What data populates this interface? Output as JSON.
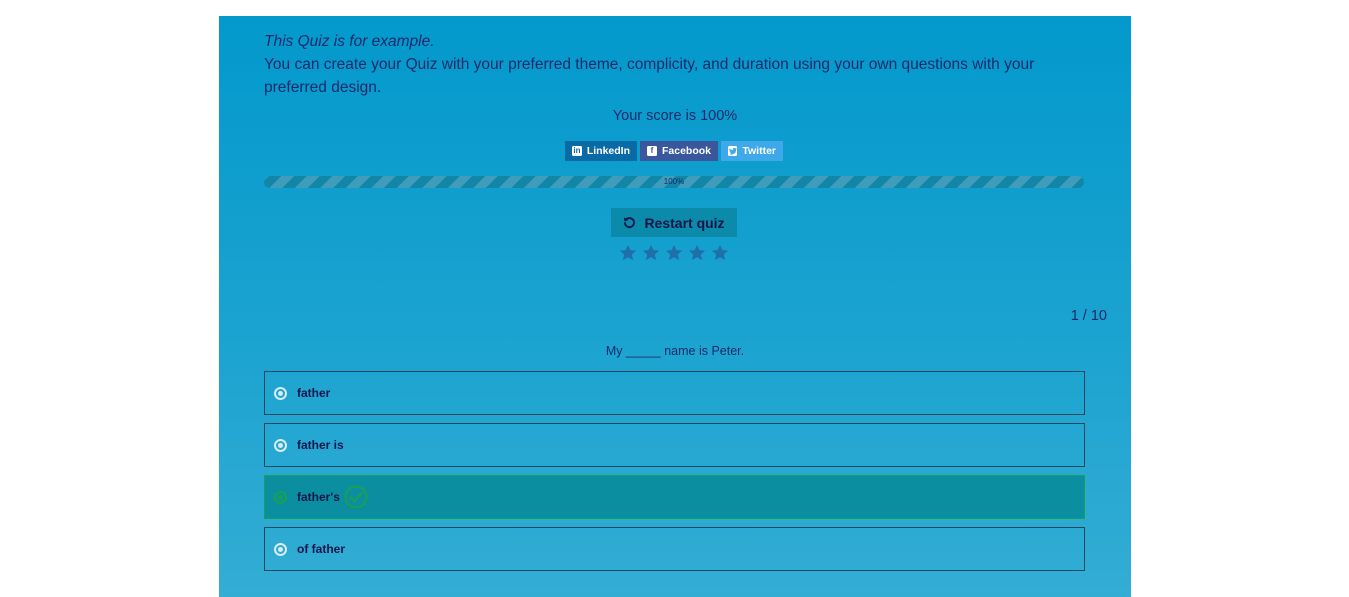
{
  "intro": {
    "line1": "This Quiz is for example.",
    "line2": "You can create your Quiz with your preferred theme, complicity, and duration using your own questions with your preferred design."
  },
  "score_text": "Your score is 100%",
  "share": {
    "linkedin": "LinkedIn",
    "facebook": "Facebook",
    "twitter": "Twitter"
  },
  "progress": {
    "value": 100,
    "label": "100%"
  },
  "restart_label": "Restart quiz",
  "rating": {
    "stars": 5,
    "selected": 0
  },
  "counter": "1 / 10",
  "question": "My _____ name is Peter.",
  "answers": [
    {
      "label": "father",
      "correct": false
    },
    {
      "label": "father is",
      "correct": false
    },
    {
      "label": "father's",
      "correct": true
    },
    {
      "label": "of father",
      "correct": false
    }
  ],
  "colors": {
    "panel_top": "#0399cc",
    "panel_bottom": "#33add4",
    "correct_bg": "#0b8fa0",
    "correct_accent": "#1aa052",
    "text": "#1b2a6b"
  }
}
